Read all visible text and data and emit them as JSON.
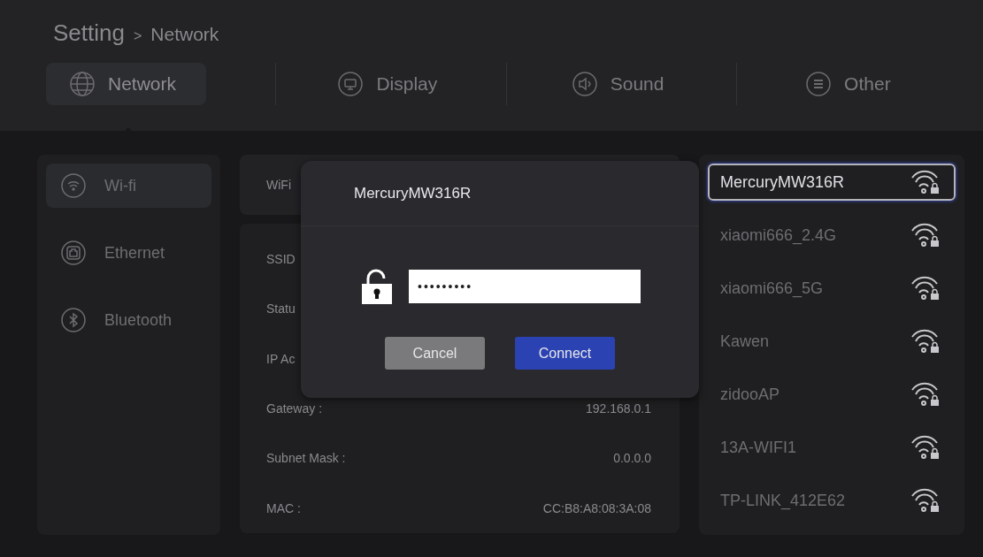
{
  "breadcrumb": {
    "root": "Setting",
    "separator": ">",
    "current": "Network"
  },
  "tabs": [
    {
      "label": "Network",
      "selected": true
    },
    {
      "label": "Display",
      "selected": false
    },
    {
      "label": "Sound",
      "selected": false
    },
    {
      "label": "Other",
      "selected": false
    }
  ],
  "sidebar": {
    "items": [
      {
        "label": "Wi-fi",
        "selected": true
      },
      {
        "label": "Ethernet",
        "selected": false
      },
      {
        "label": "Bluetooth",
        "selected": false
      }
    ]
  },
  "wifi_bar": {
    "label": "WiFi"
  },
  "info": {
    "rows": [
      {
        "label": "SSID"
      },
      {
        "label": "Statu"
      },
      {
        "label": "IP Ac"
      },
      {
        "label": "Gateway :",
        "value": "192.168.0.1"
      },
      {
        "label": "Subnet Mask :",
        "value": "0.0.0.0"
      },
      {
        "label": "MAC :",
        "value": "CC:B8:A8:08:3A:08"
      }
    ]
  },
  "dialog": {
    "title": "MercuryMW316R",
    "password": "•••••••••",
    "buttons": [
      {
        "label": "Cancel",
        "kind": "secondary"
      },
      {
        "label": "Connect",
        "kind": "primary"
      }
    ]
  },
  "networks": [
    {
      "name": "MercuryMW316R",
      "selected": true
    },
    {
      "name": "xiaomi666_2.4G",
      "selected": false
    },
    {
      "name": "xiaomi666_5G",
      "selected": false
    },
    {
      "name": "Kawen",
      "selected": false
    },
    {
      "name": "zidooAP",
      "selected": false
    },
    {
      "name": "13A-WIFI1",
      "selected": false
    },
    {
      "name": "TP-LINK_412E62",
      "selected": false
    }
  ]
}
